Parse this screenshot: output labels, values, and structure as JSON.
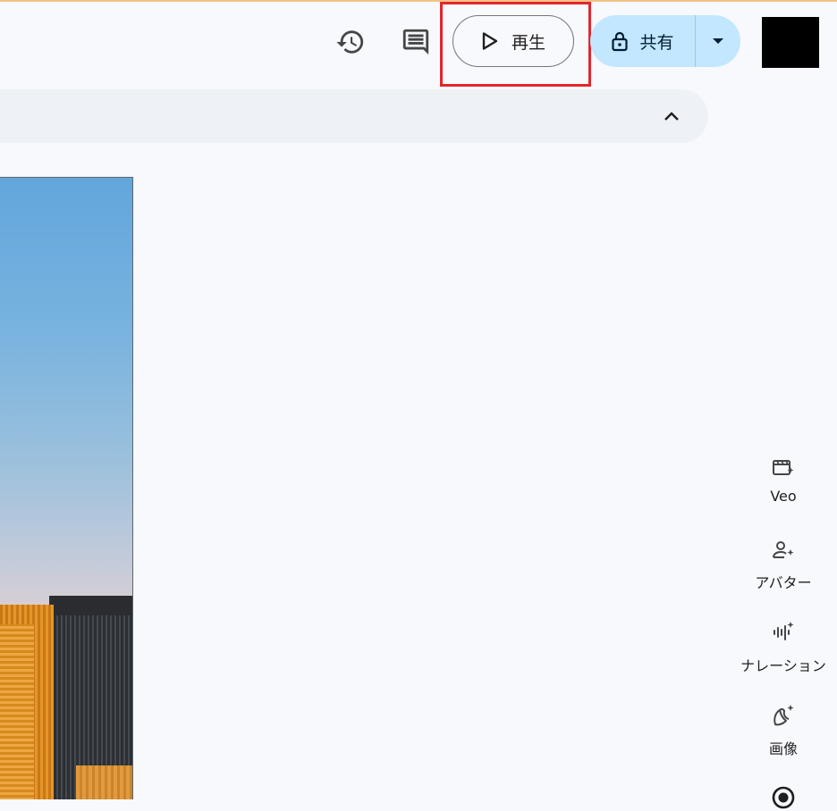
{
  "toolbar": {
    "history_icon": "history-icon",
    "comments_icon": "comment-icon",
    "play_label": "再生",
    "play_icon": "play-icon",
    "share_label": "共有",
    "share_icon": "lock-icon",
    "share_dropdown_icon": "caret-down-icon"
  },
  "panel": {
    "collapse_icon": "chevron-up-icon"
  },
  "side_tools": [
    {
      "label": "Veo",
      "icon": "video-sparkle-icon"
    },
    {
      "label": "アバター",
      "icon": "person-sparkle-icon"
    },
    {
      "label": "ナレーション",
      "icon": "audio-sparkle-icon"
    },
    {
      "label": "画像",
      "icon": "banana-sparkle-icon"
    },
    {
      "label": "",
      "icon": "record-icon"
    }
  ],
  "colors": {
    "background": "#f8f9fd",
    "share_bg": "#c2e7ff",
    "highlight": "#e3262b"
  }
}
